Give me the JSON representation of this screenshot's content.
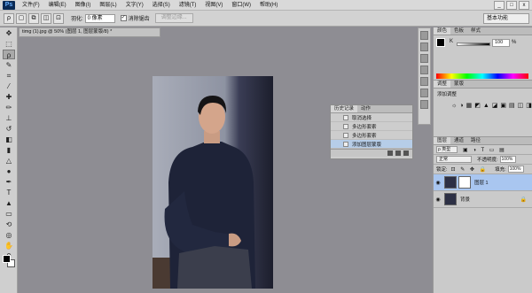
{
  "menubar": {
    "logo": "Ps",
    "items": [
      "文件(F)",
      "编辑(E)",
      "图像(I)",
      "图层(L)",
      "文字(Y)",
      "选择(S)",
      "滤镜(T)",
      "视图(V)",
      "窗口(W)",
      "帮助(H)"
    ],
    "controls": [
      "_",
      "□",
      "x"
    ]
  },
  "options": {
    "feather_label": "羽化:",
    "feather_value": "0 像素",
    "antialias_label": "消除锯齿",
    "refine_button": "调整边缘..."
  },
  "workspace": "基本功能",
  "document": {
    "tab": "timg (1).jpg @ 50% (图层 1, 图层蒙版/8) *"
  },
  "history": {
    "tabs": [
      "历史记录",
      "动作"
    ],
    "items": [
      "取消选择",
      "多边形套索",
      "多边形套索",
      "添加图层蒙版"
    ]
  },
  "color_panel": {
    "tabs": [
      "颜色",
      "色板",
      "样式"
    ],
    "channel": "K",
    "value": "100",
    "unit": "%"
  },
  "adjustments": {
    "tabs": [
      "调整",
      "蒙版"
    ],
    "title": "添加调整"
  },
  "layers": {
    "tabs": [
      "图层",
      "通道",
      "路径"
    ],
    "filter": "ρ 类型",
    "blend_mode": "正常",
    "opacity_label": "不透明度:",
    "opacity_value": "100%",
    "lock_label": "锁定:",
    "fill_label": "填充:",
    "fill_value": "100%",
    "items": [
      {
        "name": "图层 1"
      },
      {
        "name": "背景"
      }
    ]
  },
  "colors": {
    "accent": "#a9c6f0",
    "bg": "#8e8d93"
  }
}
